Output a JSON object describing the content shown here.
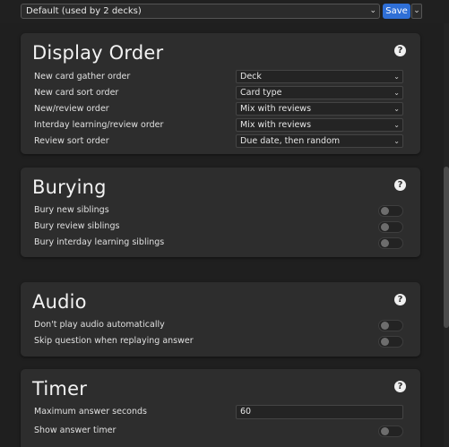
{
  "topbar": {
    "preset": "Default (used by 2 decks)",
    "save_label": "Save"
  },
  "sections": {
    "display_order": {
      "title": "Display Order",
      "rows": [
        {
          "label": "New card gather order",
          "value": "Deck"
        },
        {
          "label": "New card sort order",
          "value": "Card type"
        },
        {
          "label": "New/review order",
          "value": "Mix with reviews"
        },
        {
          "label": "Interday learning/review order",
          "value": "Mix with reviews"
        },
        {
          "label": "Review sort order",
          "value": "Due date, then random"
        }
      ]
    },
    "burying": {
      "title": "Burying",
      "rows": [
        {
          "label": "Bury new siblings",
          "on": false
        },
        {
          "label": "Bury review siblings",
          "on": false
        },
        {
          "label": "Bury interday learning siblings",
          "on": false
        }
      ]
    },
    "audio": {
      "title": "Audio",
      "rows": [
        {
          "label": "Don't play audio automatically",
          "on": false
        },
        {
          "label": "Skip question when replaying answer",
          "on": false
        }
      ]
    },
    "timer": {
      "title": "Timer",
      "max_answer_label": "Maximum answer seconds",
      "max_answer_value": "60",
      "show_timer_label": "Show answer timer",
      "show_timer_on": false
    }
  },
  "icons": {
    "help": "question-circle-icon",
    "chevron": "chevron-down-icon"
  },
  "colors": {
    "accent": "#2f6fd6",
    "card_bg": "#2d2d2d",
    "page_bg": "#1f1f1f"
  }
}
